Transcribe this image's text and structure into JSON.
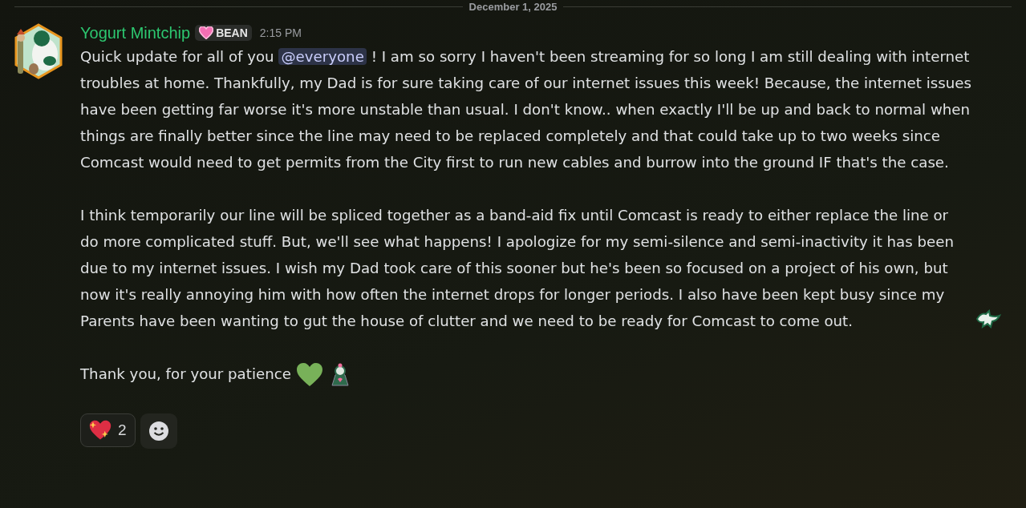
{
  "date_divider": "December 1, 2025",
  "message": {
    "author": "Yogurt Mintchip",
    "badge": "BEAN",
    "time": "2:15 PM",
    "paragraphs": [
      {
        "before": "Quick update for all of you",
        "mention": "@everyone",
        "after": "! I am so sorry I haven't been streaming for so long I am still dealing with internet troubles at home. Thankfully, my Dad is for sure taking care of our internet issues this week! Because, the internet issues have been getting far worse it's more unstable than usual. I don't know.. when exactly I'll be up and back to normal when things are finally better since the line may need to be replaced completely and that could take up to two weeks since Comcast would need to get permits from the City first to run new cables and burrow into the ground IF that's the case."
      },
      {
        "before": "I think temporarily our line will be spliced together as a band-aid fix until Comcast is ready to either replace the line or do more complicated stuff. But, we'll see what happens! I apologize for my semi-silence and semi-inactivity it has been due to my internet issues. I wish my Dad took care of this sooner but he's been so focused on a project of his own, but now it's really annoying him with how often the internet drops for longer periods. I also have been kept busy since my Parents have been wanting to gut the house of clutter and we need to be ready for Comcast to come out."
      },
      {
        "before": "Thank you, for your patience"
      }
    ],
    "reactions": [
      {
        "count": "2"
      }
    ]
  }
}
